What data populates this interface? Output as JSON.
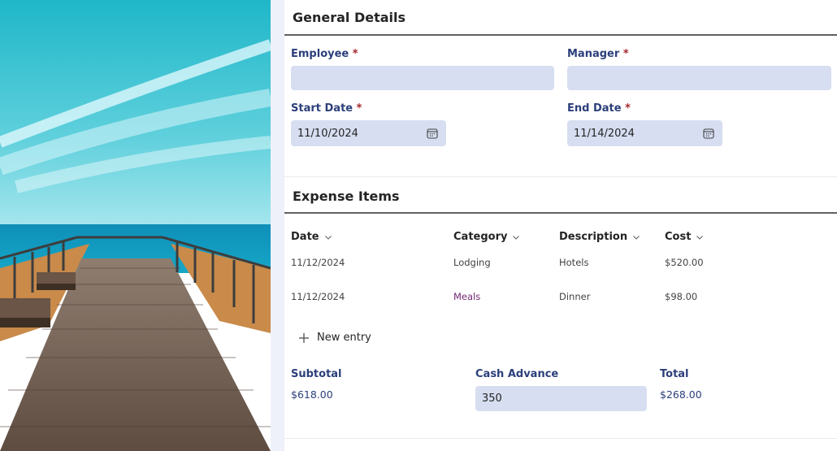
{
  "general": {
    "title": "General Details",
    "employee_label": "Employee",
    "employee_value": "",
    "manager_label": "Manager",
    "manager_value": "",
    "start_date_label": "Start Date",
    "start_date_value": "11/10/2024",
    "end_date_label": "End Date",
    "end_date_value": "11/14/2024",
    "required_mark": "*"
  },
  "expenses": {
    "title": "Expense Items",
    "columns": [
      "Date",
      "Category",
      "Description",
      "Cost"
    ],
    "rows": [
      {
        "date": "11/12/2024",
        "category": "Lodging",
        "description": "Hotels",
        "cost": "$520.00"
      },
      {
        "date": "11/12/2024",
        "category": "Meals",
        "description": "Dinner",
        "cost": "$98.00"
      }
    ],
    "new_entry_label": "New entry"
  },
  "totals": {
    "subtotal_label": "Subtotal",
    "subtotal_value": "$618.00",
    "cash_advance_label": "Cash Advance",
    "cash_advance_value": "350",
    "total_label": "Total",
    "total_value": "$268.00"
  },
  "icons": {
    "calendar": "calendar-icon",
    "chevron": "chevron-down-icon",
    "plus": "plus-icon"
  },
  "colors": {
    "label": "#2b3f7a",
    "field_bg": "#d7def1",
    "required": "#a4262c",
    "meals": "#742774"
  }
}
